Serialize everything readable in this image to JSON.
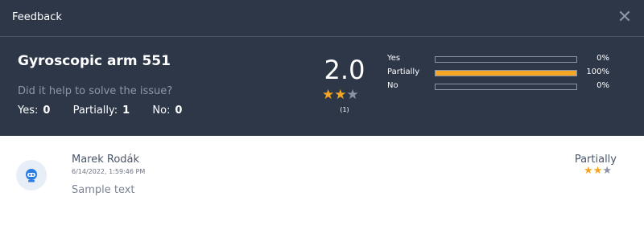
{
  "window": {
    "title": "Feedback",
    "close_icon": "close-icon"
  },
  "summary": {
    "product": "Gyroscopic arm 551",
    "question": "Did it help to solve the issue?",
    "counts": [
      {
        "label": "Yes:",
        "value": "0"
      },
      {
        "label": "Partially:",
        "value": "1"
      },
      {
        "label": "No:",
        "value": "0"
      }
    ],
    "score": "2.0",
    "rating": 2,
    "max_rating": 3,
    "rating_count": "(1)",
    "bars": [
      {
        "label": "Yes",
        "percent_text": "0%",
        "fraction": 0
      },
      {
        "label": "Partially",
        "percent_text": "100%",
        "fraction": 1
      },
      {
        "label": "No",
        "percent_text": "0%",
        "fraction": 0
      }
    ]
  },
  "review": {
    "avatar_icon": "robot-avatar-icon",
    "author": "Marek Rodák",
    "timestamp": "6/14/2022, 1:59:46 PM",
    "comment": "Sample text",
    "answer": "Partially",
    "rating": 2,
    "max_rating": 3
  },
  "colors": {
    "header_bg": "#2d3748",
    "accent": "#f5a623",
    "star_off": "#8a94a6"
  }
}
